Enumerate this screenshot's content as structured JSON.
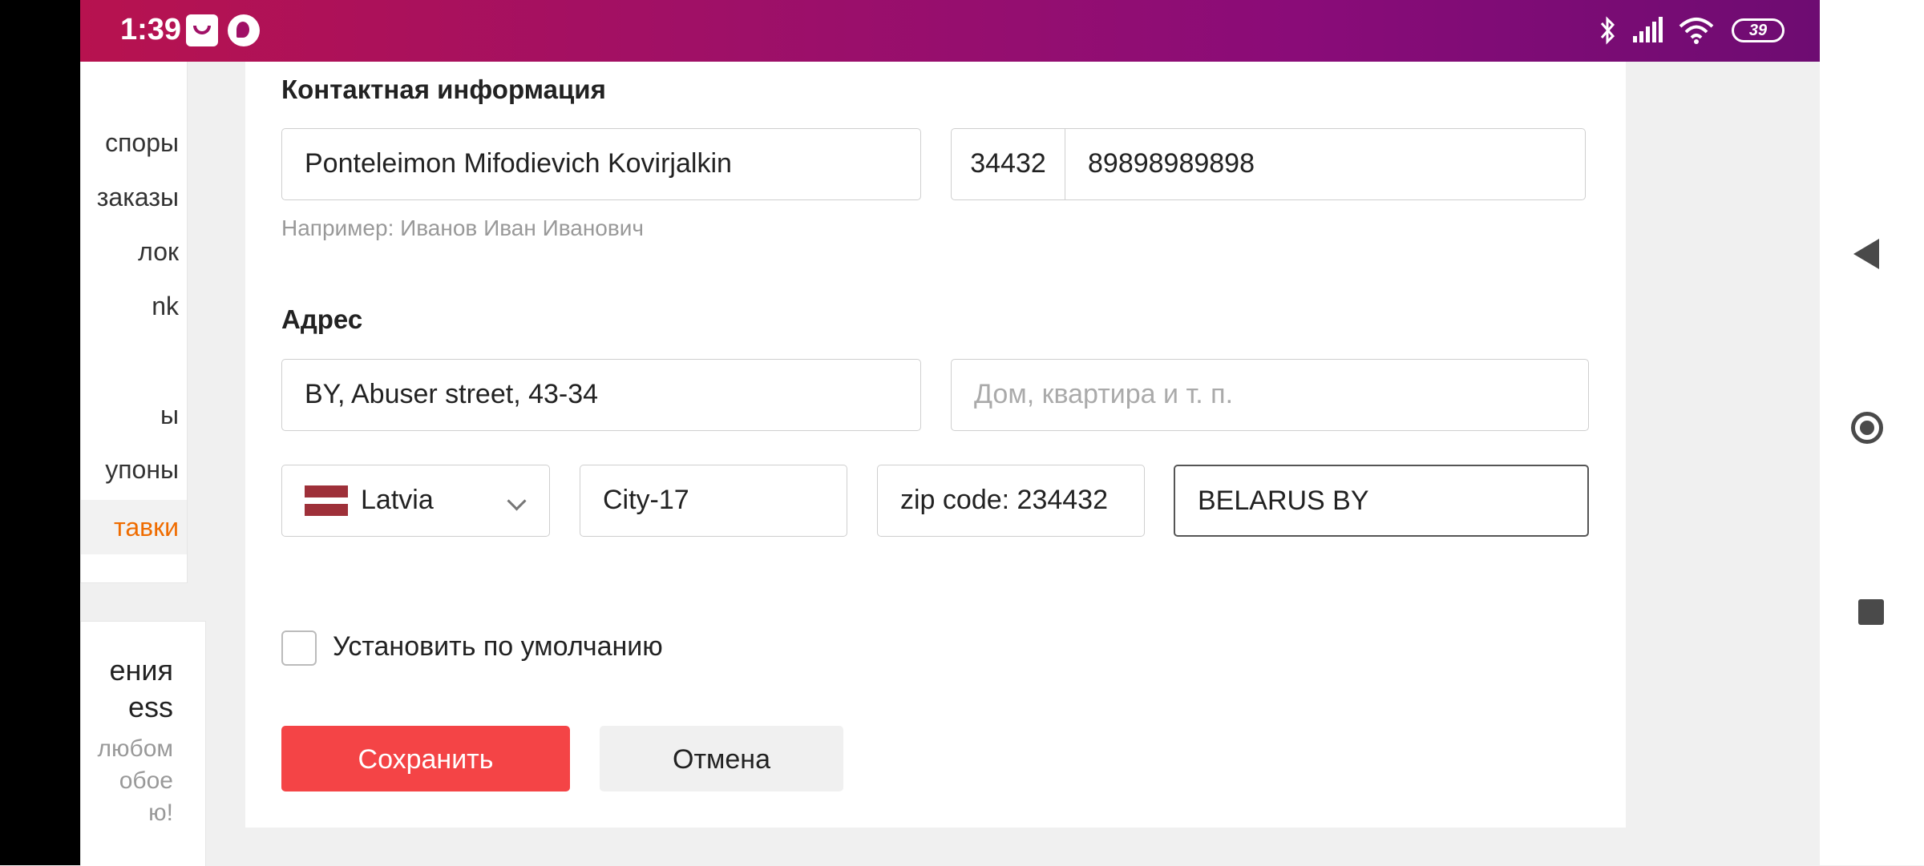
{
  "statusbar": {
    "time": "1:39",
    "battery": "39",
    "icons": [
      "shopping-bag-icon",
      "firefox-icon",
      "bluetooth-icon",
      "signal-icon",
      "wifi-icon",
      "battery-icon"
    ]
  },
  "sidebar": {
    "items": [
      {
        "label": "споры"
      },
      {
        "label": "заказы"
      },
      {
        "label": "лок"
      },
      {
        "label": "nk"
      },
      {
        "label": "ы"
      },
      {
        "label": "упоны"
      },
      {
        "label": "тавки",
        "active": true
      }
    ]
  },
  "promo": {
    "title_line1": "ения",
    "title_line2": "ess",
    "sub_line1": "любом",
    "sub_line2": "обое",
    "sub_line3": "ю!"
  },
  "contact": {
    "title": "Контактная информация",
    "name_value": "Ponteleimon Mifodievich Kovirjalkin",
    "name_hint": "Например: Иванов Иван Иванович",
    "phone_code": "34432",
    "phone_number": "89898989898"
  },
  "address": {
    "title": "Адрес",
    "street_value": "BY, Abuser street, 43-34",
    "apartment_placeholder": "Дом, квартира и т. п.",
    "country": "Latvia",
    "city_value": "City-17",
    "zip_value": "zip code: 234432",
    "region_value": "BELARUS BY"
  },
  "default_checkbox": {
    "label": "Установить по умолчанию",
    "checked": false
  },
  "actions": {
    "save_label": "Сохранить",
    "cancel_label": "Отмена"
  },
  "colors": {
    "accent": "#f44446",
    "active_menu": "#ef6c00",
    "statusbar_start": "#b7124f",
    "statusbar_end": "#6e0c72"
  }
}
